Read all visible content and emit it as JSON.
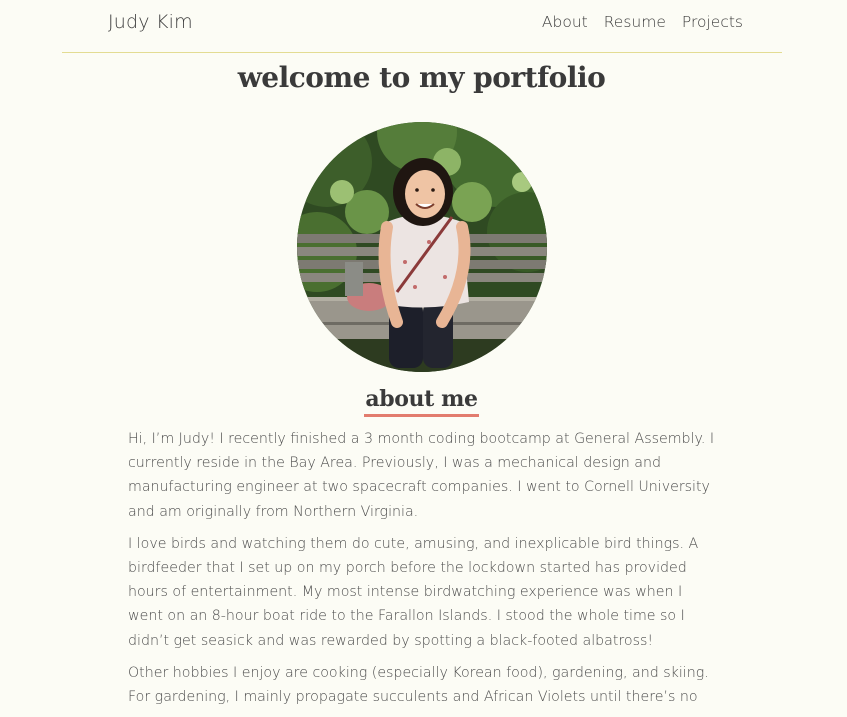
{
  "nav": {
    "brand": "Judy Kim",
    "links": [
      "About",
      "Resume",
      "Projects"
    ]
  },
  "main": {
    "title": "welcome to my portfolio",
    "about_heading": "about me",
    "paragraphs": [
      "Hi, I’m Judy! I recently finished a 3 month coding bootcamp at General Assembly. I currently reside in the Bay Area. Previously, I was a mechanical design and manufacturing engineer at two spacecraft companies. I went to Cornell University and am originally from Northern Virginia.",
      "I love birds and watching them do cute, amusing, and inexplicable bird things. A birdfeeder that I set up on my porch before the lockdown started has provided hours of entertainment. My most intense birdwatching experience was when I went on an 8-hour boat ride to the Farallon Islands. I stood the whole time so I didn’t get seasick and was rewarded by spotting a black-footed albatross!",
      "Other hobbies I enjoy are cooking (especially Korean food), gardening, and skiing. For gardening, I mainly propagate succulents and African Violets until there’s no"
    ]
  },
  "colors": {
    "background": "#fcfcf5",
    "nav_underline": "#e3dc92",
    "heading_underline": "#e27c6e",
    "text": "#4d4d4d"
  }
}
